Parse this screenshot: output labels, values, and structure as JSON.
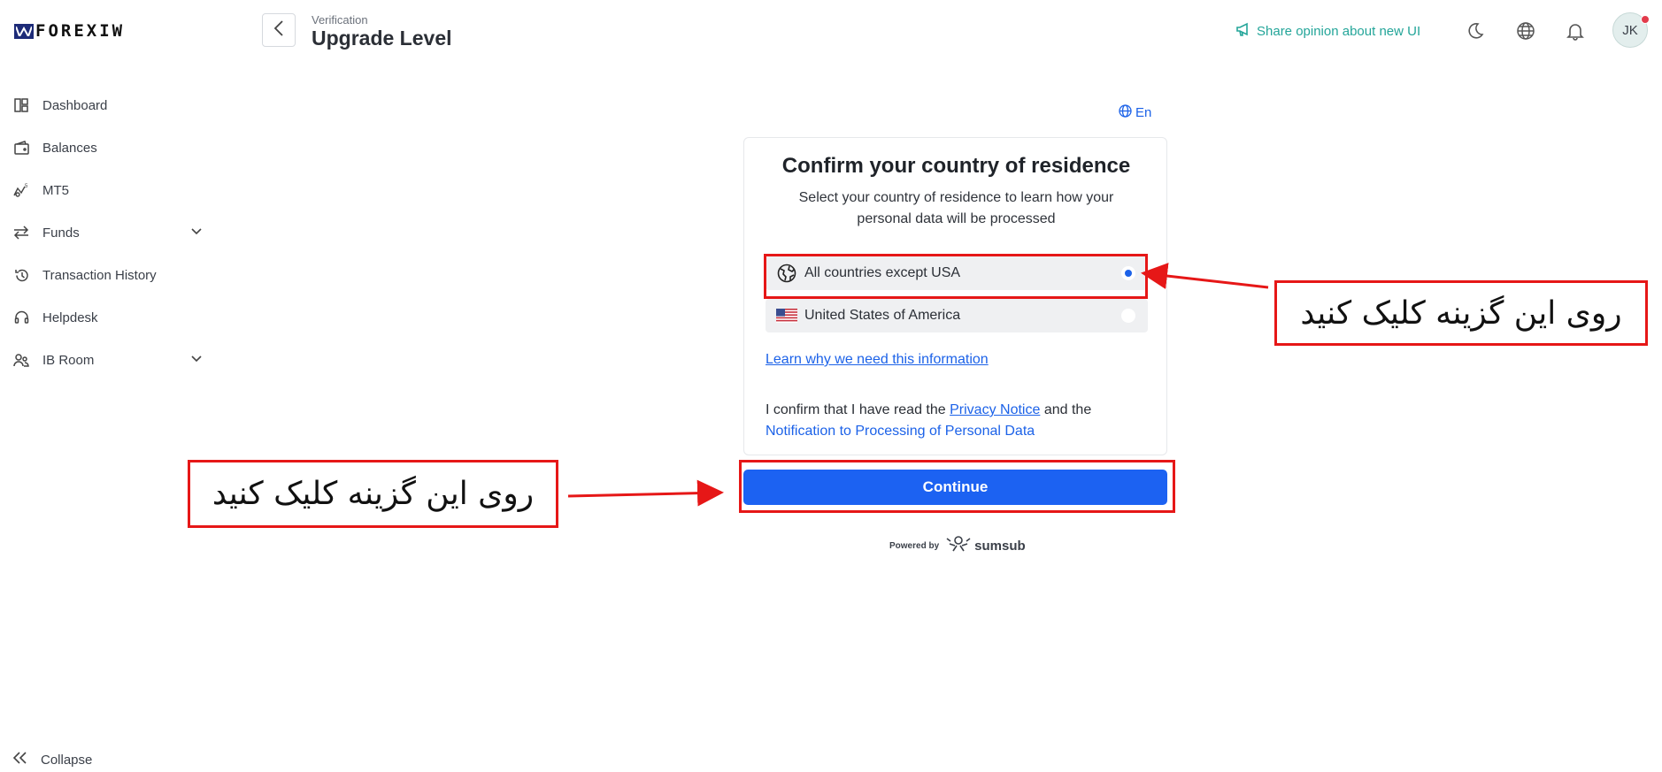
{
  "brand": {
    "logo_text": "FOREXIW"
  },
  "sidebar": {
    "items": [
      {
        "label": "Dashboard",
        "icon": "dashboard-icon"
      },
      {
        "label": "Balances",
        "icon": "wallet-icon"
      },
      {
        "label": "MT5",
        "icon": "mt5-icon"
      },
      {
        "label": "Funds",
        "icon": "transfer-icon"
      },
      {
        "label": "Transaction History",
        "icon": "history-icon"
      },
      {
        "label": "Helpdesk",
        "icon": "headset-icon"
      },
      {
        "label": "IB Room",
        "icon": "users-icon"
      }
    ],
    "collapse_label": "Collapse"
  },
  "header": {
    "breadcrumb": "Verification",
    "title": "Upgrade Level",
    "share_label": "Share opinion about new UI",
    "avatar_initials": "JK"
  },
  "sumsub": {
    "language": "En",
    "title": "Confirm your country of residence",
    "subtitle": "Select your country of residence to learn how your personal data will be processed",
    "options": [
      {
        "label": "All countries except USA",
        "selected": true
      },
      {
        "label": "United States of America",
        "selected": false
      }
    ],
    "learn_link": "Learn why we need this information",
    "confirm_prefix": "I confirm that I have read the",
    "privacy_link": "Privacy Notice",
    "confirm_middle": "and the",
    "notification_link": "Notification to Processing of Personal Data",
    "continue_label": "Continue",
    "powered_by": "Powered by",
    "powered_brand": "sumsub"
  },
  "annotations": {
    "option_note": "روی این گزینه کلیک کنید",
    "continue_note": "روی این گزینه کلیک کنید",
    "color": "#e61717"
  },
  "colors": {
    "accent": "#1c62f2",
    "share": "#23a599"
  }
}
